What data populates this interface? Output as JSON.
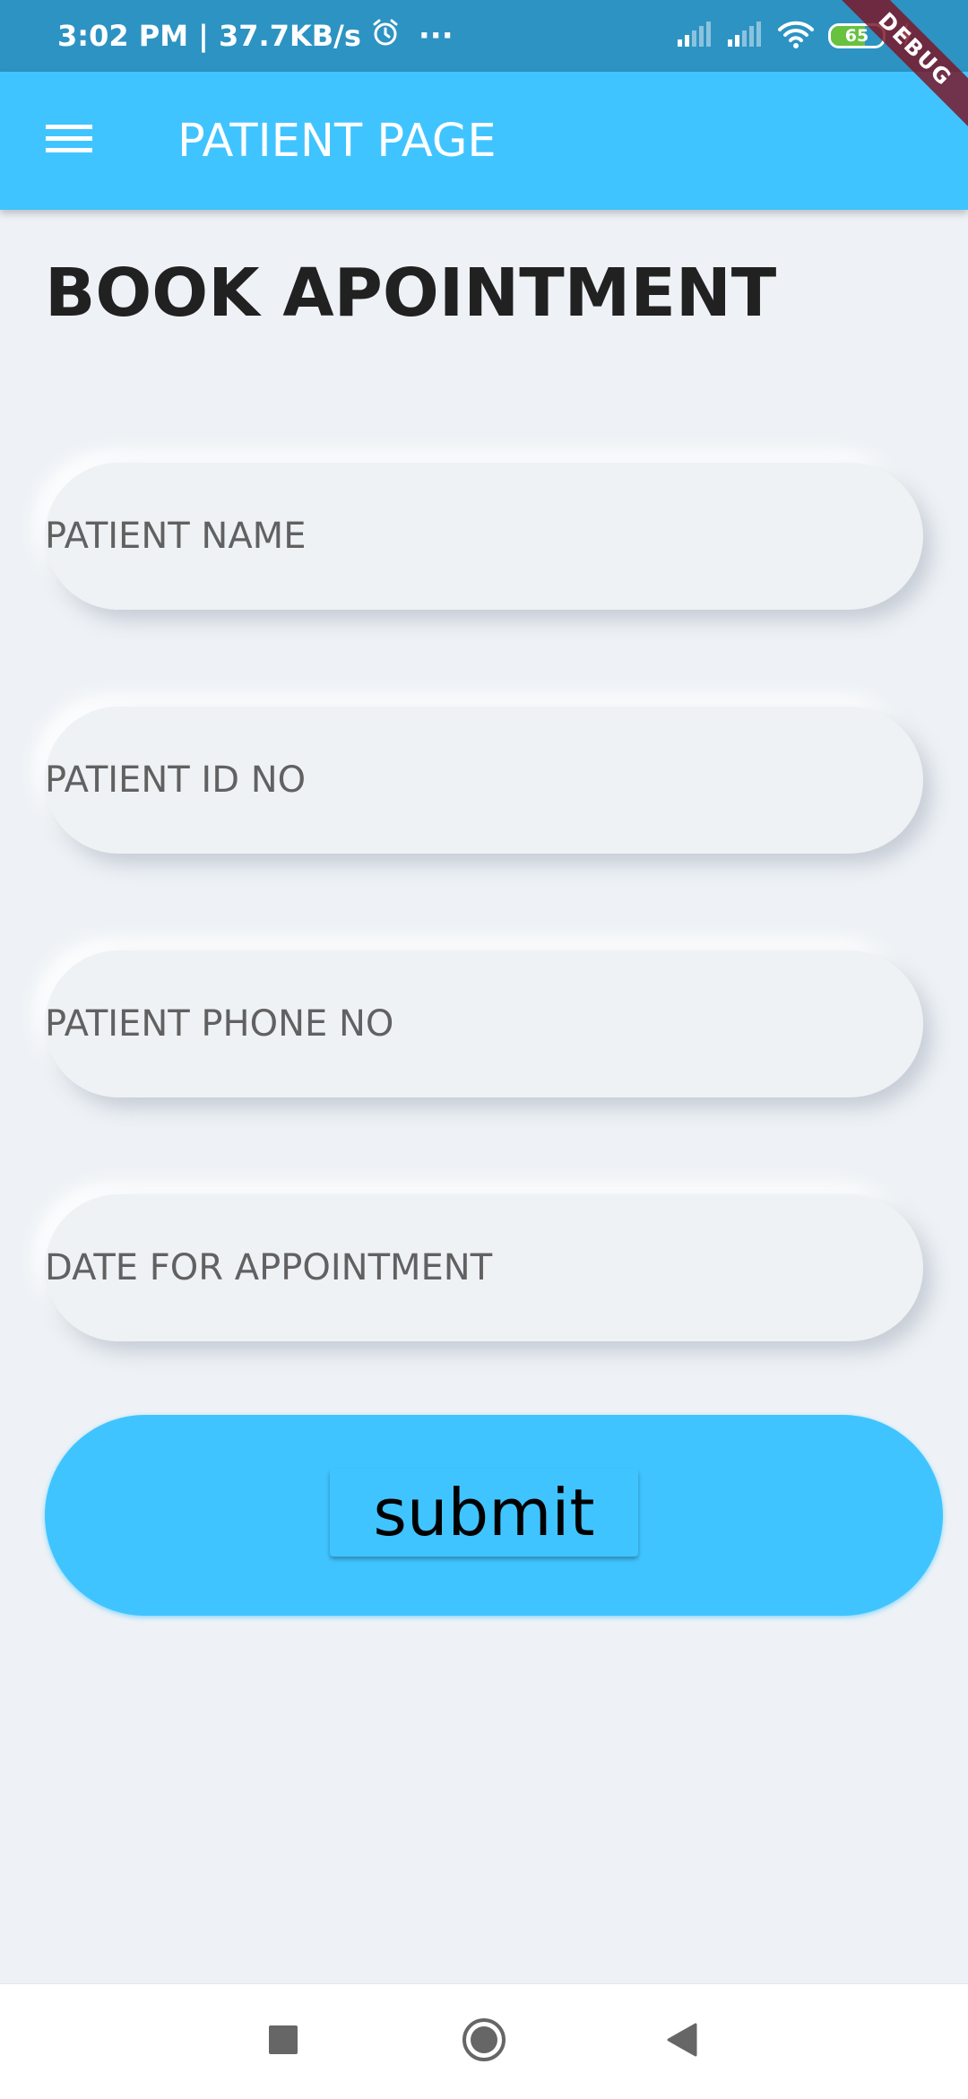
{
  "status_bar": {
    "time_speed": "3:02 PM | 37.7KB/s",
    "alarm_icon": "alarm-clock-icon",
    "more_dots": "···",
    "battery_level": "65",
    "battery_fraction": 0.65,
    "background_color": "#2d93c3"
  },
  "app_bar": {
    "title": "PATIENT PAGE",
    "menu_icon": "hamburger-menu-icon",
    "color": "#40c4ff"
  },
  "debug_banner": "DEBUG",
  "page": {
    "heading": "BOOK APOINTMENT"
  },
  "form": {
    "fields": [
      {
        "placeholder": "PATIENT NAME",
        "value": ""
      },
      {
        "placeholder": "PATIENT ID NO",
        "value": ""
      },
      {
        "placeholder": "PATIENT PHONE NO",
        "value": ""
      },
      {
        "placeholder": "DATE FOR APPOINTMENT",
        "value": ""
      }
    ],
    "submit_label": "submit"
  },
  "nav_bar": {
    "recents_icon": "square-recents-icon",
    "home_icon": "circle-home-icon",
    "back_icon": "triangle-back-icon"
  },
  "colors": {
    "accent": "#40c4ff",
    "background": "#eef2f6",
    "heading_text": "#212121",
    "placeholder_text": "#616161",
    "debug_ribbon": "#7d1423"
  }
}
